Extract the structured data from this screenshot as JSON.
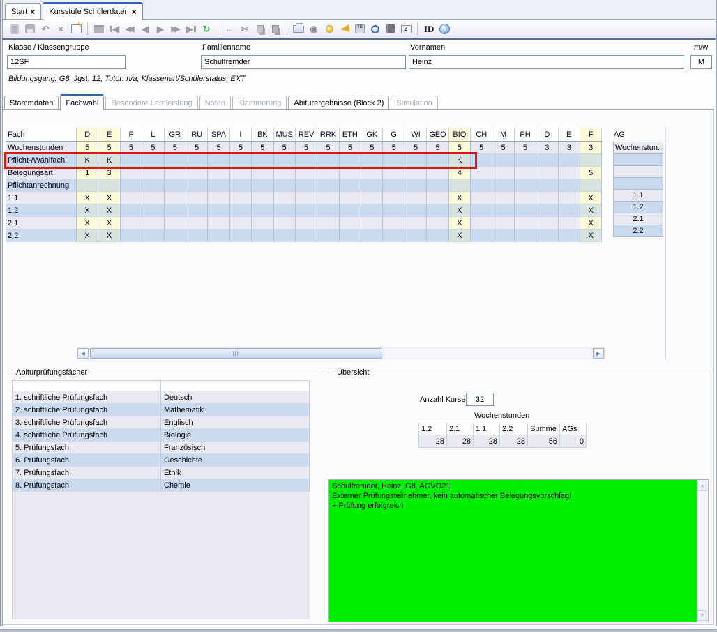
{
  "window_tabs": [
    {
      "label": "Start",
      "close": "×",
      "active": false
    },
    {
      "label": "Kursstufe Schülerdaten",
      "close": "×",
      "active": true
    }
  ],
  "toolbar": {
    "groups": [
      {
        "icons": [
          {
            "name": "new-record-icon",
            "shape": "doc"
          },
          {
            "name": "save-icon",
            "shape": "floppy"
          },
          {
            "name": "undo-icon",
            "glyph": "↶"
          },
          {
            "name": "delete-record-icon",
            "glyph": "×"
          },
          {
            "name": "edit-record-icon",
            "shape": "edit"
          }
        ]
      },
      {
        "icons": [
          {
            "name": "record-list-icon",
            "shape": "list"
          },
          {
            "name": "first-record-icon",
            "glyph": "◀",
            "bar": "left"
          },
          {
            "name": "fast-back-icon",
            "glyph": "◀◀",
            "cls": "dbl"
          },
          {
            "name": "previous-record-icon",
            "glyph": "◀"
          },
          {
            "name": "next-record-icon",
            "glyph": "▶"
          },
          {
            "name": "fast-forward-icon",
            "glyph": "▶▶",
            "cls": "dbl"
          },
          {
            "name": "last-record-icon",
            "glyph": "▶",
            "bar": "right"
          },
          {
            "name": "refresh-icon",
            "glyph": "↻",
            "color": "#3fae49"
          }
        ]
      },
      {
        "icons": [
          {
            "name": "back-icon",
            "glyph": "←"
          },
          {
            "name": "cut-icon",
            "glyph": "✂"
          },
          {
            "name": "copy-icon",
            "shape": "copy"
          },
          {
            "name": "paste-icon",
            "shape": "paste"
          }
        ]
      },
      {
        "icons": [
          {
            "name": "print-icon",
            "shape": "printer"
          },
          {
            "name": "record-disc-icon",
            "glyph": "◉",
            "color": "#8a8a92"
          },
          {
            "name": "hint-bulb-icon",
            "shape": "bulb"
          },
          {
            "name": "announce-horn-icon",
            "shape": "horn"
          },
          {
            "name": "timetable-tb-icon",
            "shape": "tb",
            "mini": "TB"
          },
          {
            "name": "clock-icon",
            "shape": "clock"
          },
          {
            "name": "report-book-icon",
            "shape": "book"
          },
          {
            "name": "print-z-icon",
            "shape": "printz",
            "mini": "Z"
          }
        ]
      },
      {
        "icons": [
          {
            "name": "id-label",
            "text": "ID"
          },
          {
            "name": "help-icon",
            "shape": "help",
            "mini": "?"
          }
        ]
      }
    ]
  },
  "form": {
    "klasse_label": "Klasse / Klassengruppe",
    "klasse_value": "12SF",
    "familienname_label": "Familienname",
    "familienname_value": "Schulfremder",
    "vornamen_label": "Vornamen",
    "vornamen_value": "Heinz",
    "mw_label": "m/w",
    "mw_value": "M",
    "info_line": "Bildungsgang: G8, Jgst. 12, Tutor: n/a, Klassenart/Schülerstatus: EXT"
  },
  "tabs": [
    {
      "label": "Stammdaten",
      "state": "normal"
    },
    {
      "label": "Fachwahl",
      "state": "active"
    },
    {
      "label": "Besondere Lernleistung",
      "state": "disabled"
    },
    {
      "label": "Noten",
      "state": "disabled"
    },
    {
      "label": "Klammerung",
      "state": "disabled"
    },
    {
      "label": "Abiturergebnisse (Block 2)",
      "state": "normal"
    },
    {
      "label": "Simulation",
      "state": "disabled"
    }
  ],
  "grid": {
    "corner_label": "Fach",
    "columns": [
      "D",
      "E",
      "F",
      "L",
      "GR",
      "RU",
      "SPA",
      "I",
      "BK",
      "MUS",
      "REV",
      "RRK",
      "ETH",
      "GK",
      "G",
      "WI",
      "GEO",
      "BIO",
      "CH",
      "M",
      "PH",
      "D",
      "E",
      "F"
    ],
    "highlight_columns": [
      0,
      1,
      17,
      23
    ],
    "rows": [
      {
        "label": "Wochenstunden",
        "shade": "light",
        "cells": [
          "5",
          "5",
          "5",
          "5",
          "5",
          "5",
          "5",
          "5",
          "5",
          "5",
          "5",
          "5",
          "5",
          "5",
          "5",
          "5",
          "5",
          "5",
          "5",
          "5",
          "5",
          "3",
          "3",
          "3"
        ]
      },
      {
        "label": "Pflicht-/Wahlfach",
        "shade": "blue",
        "cells": [
          "K",
          "K",
          "",
          "",
          "",
          "",
          "",
          "",
          "",
          "",
          "",
          "",
          "",
          "",
          "",
          "",
          "",
          "K",
          "",
          "",
          "",
          "",
          "",
          ""
        ]
      },
      {
        "label": "Belegungsart",
        "shade": "light",
        "cells": [
          "1",
          "3",
          "",
          "",
          "",
          "",
          "",
          "",
          "",
          "",
          "",
          "",
          "",
          "",
          "",
          "",
          "",
          "4",
          "",
          "",
          "",
          "",
          "",
          "5"
        ]
      },
      {
        "label": "Pflichtanrechnung",
        "shade": "blue",
        "cells": [
          "",
          "",
          "",
          "",
          "",
          "",
          "",
          "",
          "",
          "",
          "",
          "",
          "",
          "",
          "",
          "",
          "",
          "",
          "",
          "",
          "",
          "",
          "",
          ""
        ]
      },
      {
        "label": "1.1",
        "shade": "light",
        "cells": [
          "X",
          "X",
          "",
          "",
          "",
          "",
          "",
          "",
          "",
          "",
          "",
          "",
          "",
          "",
          "",
          "",
          "",
          "X",
          "",
          "",
          "",
          "",
          "",
          "X"
        ]
      },
      {
        "label": "1.2",
        "shade": "blue",
        "cells": [
          "X",
          "X",
          "",
          "",
          "",
          "",
          "",
          "",
          "",
          "",
          "",
          "",
          "",
          "",
          "",
          "",
          "",
          "X",
          "",
          "",
          "",
          "",
          "",
          "X"
        ]
      },
      {
        "label": "2.1",
        "shade": "light",
        "cells": [
          "X",
          "X",
          "",
          "",
          "",
          "",
          "",
          "",
          "",
          "",
          "",
          "",
          "",
          "",
          "",
          "",
          "",
          "X",
          "",
          "",
          "",
          "",
          "",
          "X"
        ]
      },
      {
        "label": "2.2",
        "shade": "blue",
        "cells": [
          "X",
          "X",
          "",
          "",
          "",
          "",
          "",
          "",
          "",
          "",
          "",
          "",
          "",
          "",
          "",
          "",
          "",
          "X",
          "",
          "",
          "",
          "",
          "",
          "X"
        ]
      }
    ]
  },
  "ag_panel": {
    "title": "AG",
    "rows": [
      {
        "label": "Wochenstun...",
        "shade": "head"
      },
      {
        "label": "",
        "shade": "blue"
      },
      {
        "label": "",
        "shade": "light"
      },
      {
        "label": "",
        "shade": "blue"
      },
      {
        "label": "1.1",
        "shade": "light"
      },
      {
        "label": "1.2",
        "shade": "blue"
      },
      {
        "label": "2.1",
        "shade": "light"
      },
      {
        "label": "2.2",
        "shade": "blue"
      }
    ]
  },
  "exam_box": {
    "title": "Abiturprüfungsfächer",
    "rows": [
      {
        "label": "1. schriftliche Prüfungsfach",
        "value": "Deutsch"
      },
      {
        "label": "2. schriftliche Prüfungsfach",
        "value": "Mathematik"
      },
      {
        "label": "3. schriftliche Prüfungsfach",
        "value": "Englisch"
      },
      {
        "label": "4. schriftliche Prüfungsfach",
        "value": "Biologie"
      },
      {
        "label": "5. Prüfungsfach",
        "value": "Französisch"
      },
      {
        "label": "6. Prüfungsfach",
        "value": "Geschichte"
      },
      {
        "label": "7. Prüfungsfach",
        "value": "Ethik"
      },
      {
        "label": "8. Prüfungsfach",
        "value": "Chemie"
      }
    ]
  },
  "overview": {
    "title": "Übersicht",
    "anzahl_kurse_label": "Anzahl Kurse",
    "anzahl_kurse_value": "32",
    "wochenstunden_label": "Wochenstunden",
    "summary": {
      "headers": [
        "1.2",
        "2.1",
        "1.1",
        "2.2",
        "Summe",
        "AGs"
      ],
      "values": [
        "28",
        "28",
        "28",
        "28",
        "56",
        "0"
      ]
    },
    "status_lines": [
      "Schulfremder, Heinz, G8, AGVO21",
      "Externer Prüfungsteilnehmer, kein automatischer Belegungsvorschlag!",
      "+ Prüfung erfolgreich"
    ]
  },
  "colors": {
    "status_green": "#00ee00",
    "highlight_row_border": "#de1515",
    "active_tab_accent": "#2e63b8",
    "column_highlight": "#fbfad9"
  }
}
